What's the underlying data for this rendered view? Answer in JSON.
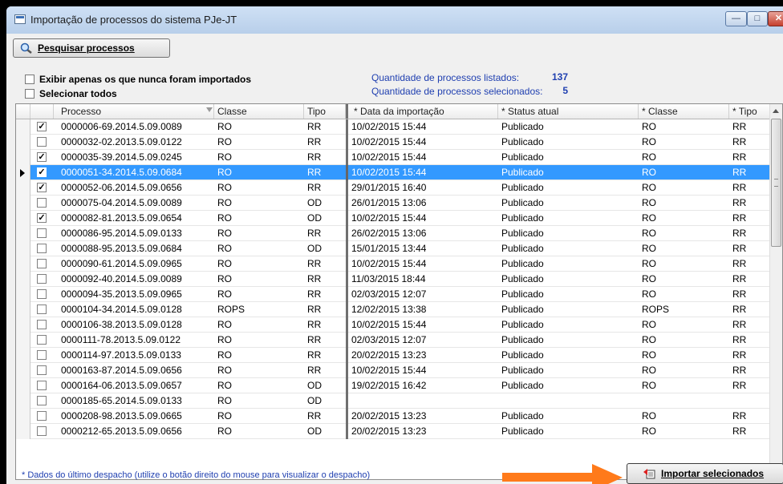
{
  "window": {
    "title": "Importação de processos do sistema PJe-JT"
  },
  "toolbar": {
    "search_label": "Pesquisar processos"
  },
  "options": {
    "only_never_imported": "Exibir apenas os que nunca foram importados",
    "select_all": "Selecionar todos"
  },
  "stats": {
    "listed_label": "Quantidade de processos listados:",
    "listed_value": "137",
    "selected_label": "Quantidade de processos selecionados:",
    "selected_value": "5"
  },
  "grid": {
    "columns": [
      "Processo",
      "Classe",
      "Tipo",
      "* Data da importação",
      "* Status atual",
      "* Classe",
      "* Tipo"
    ],
    "rows": [
      {
        "checked": true,
        "selected": false,
        "processo": "0000006-69.2014.5.09.0089",
        "classe": "RO",
        "tipo": "RR",
        "data": "10/02/2015 15:44",
        "status": "Publicado",
        "classe2": "RO",
        "tipo2": "RR"
      },
      {
        "checked": false,
        "selected": false,
        "processo": "0000032-02.2013.5.09.0122",
        "classe": "RO",
        "tipo": "RR",
        "data": "10/02/2015 15:44",
        "status": "Publicado",
        "classe2": "RO",
        "tipo2": "RR"
      },
      {
        "checked": true,
        "selected": false,
        "processo": "0000035-39.2014.5.09.0245",
        "classe": "RO",
        "tipo": "RR",
        "data": "10/02/2015 15:44",
        "status": "Publicado",
        "classe2": "RO",
        "tipo2": "RR"
      },
      {
        "checked": true,
        "selected": true,
        "processo": "0000051-34.2014.5.09.0684",
        "classe": "RO",
        "tipo": "RR",
        "data": "10/02/2015 15:44",
        "status": "Publicado",
        "classe2": "RO",
        "tipo2": "RR"
      },
      {
        "checked": true,
        "selected": false,
        "processo": "0000052-06.2014.5.09.0656",
        "classe": "RO",
        "tipo": "RR",
        "data": "29/01/2015 16:40",
        "status": "Publicado",
        "classe2": "RO",
        "tipo2": "RR"
      },
      {
        "checked": false,
        "selected": false,
        "processo": "0000075-04.2014.5.09.0089",
        "classe": "RO",
        "tipo": "OD",
        "data": "26/01/2015 13:06",
        "status": "Publicado",
        "classe2": "RO",
        "tipo2": "RR"
      },
      {
        "checked": true,
        "selected": false,
        "processo": "0000082-81.2013.5.09.0654",
        "classe": "RO",
        "tipo": "OD",
        "data": "10/02/2015 15:44",
        "status": "Publicado",
        "classe2": "RO",
        "tipo2": "RR"
      },
      {
        "checked": false,
        "selected": false,
        "processo": "0000086-95.2014.5.09.0133",
        "classe": "RO",
        "tipo": "RR",
        "data": "26/02/2015 13:06",
        "status": "Publicado",
        "classe2": "RO",
        "tipo2": "RR"
      },
      {
        "checked": false,
        "selected": false,
        "processo": "0000088-95.2013.5.09.0684",
        "classe": "RO",
        "tipo": "OD",
        "data": "15/01/2015 13:44",
        "status": "Publicado",
        "classe2": "RO",
        "tipo2": "RR"
      },
      {
        "checked": false,
        "selected": false,
        "processo": "0000090-61.2014.5.09.0965",
        "classe": "RO",
        "tipo": "RR",
        "data": "10/02/2015 15:44",
        "status": "Publicado",
        "classe2": "RO",
        "tipo2": "RR"
      },
      {
        "checked": false,
        "selected": false,
        "processo": "0000092-40.2014.5.09.0089",
        "classe": "RO",
        "tipo": "RR",
        "data": "11/03/2015 18:44",
        "status": "Publicado",
        "classe2": "RO",
        "tipo2": "RR"
      },
      {
        "checked": false,
        "selected": false,
        "processo": "0000094-35.2013.5.09.0965",
        "classe": "RO",
        "tipo": "RR",
        "data": "02/03/2015 12:07",
        "status": "Publicado",
        "classe2": "RO",
        "tipo2": "RR"
      },
      {
        "checked": false,
        "selected": false,
        "processo": "0000104-34.2014.5.09.0128",
        "classe": "ROPS",
        "tipo": "RR",
        "data": "12/02/2015 13:38",
        "status": "Publicado",
        "classe2": "ROPS",
        "tipo2": "RR"
      },
      {
        "checked": false,
        "selected": false,
        "processo": "0000106-38.2013.5.09.0128",
        "classe": "RO",
        "tipo": "RR",
        "data": "10/02/2015 15:44",
        "status": "Publicado",
        "classe2": "RO",
        "tipo2": "RR"
      },
      {
        "checked": false,
        "selected": false,
        "processo": "0000111-78.2013.5.09.0122",
        "classe": "RO",
        "tipo": "RR",
        "data": "02/03/2015 12:07",
        "status": "Publicado",
        "classe2": "RO",
        "tipo2": "RR"
      },
      {
        "checked": false,
        "selected": false,
        "processo": "0000114-97.2013.5.09.0133",
        "classe": "RO",
        "tipo": "RR",
        "data": "20/02/2015 13:23",
        "status": "Publicado",
        "classe2": "RO",
        "tipo2": "RR"
      },
      {
        "checked": false,
        "selected": false,
        "processo": "0000163-87.2014.5.09.0656",
        "classe": "RO",
        "tipo": "RR",
        "data": "10/02/2015 15:44",
        "status": "Publicado",
        "classe2": "RO",
        "tipo2": "RR"
      },
      {
        "checked": false,
        "selected": false,
        "processo": "0000164-06.2013.5.09.0657",
        "classe": "RO",
        "tipo": "OD",
        "data": "19/02/2015 16:42",
        "status": "Publicado",
        "classe2": "RO",
        "tipo2": "RR"
      },
      {
        "checked": false,
        "selected": false,
        "processo": "0000185-65.2014.5.09.0133",
        "classe": "RO",
        "tipo": "OD",
        "data": "",
        "status": "",
        "classe2": "",
        "tipo2": ""
      },
      {
        "checked": false,
        "selected": false,
        "processo": "0000208-98.2013.5.09.0665",
        "classe": "RO",
        "tipo": "RR",
        "data": "20/02/2015 13:23",
        "status": "Publicado",
        "classe2": "RO",
        "tipo2": "RR"
      },
      {
        "checked": false,
        "selected": false,
        "processo": "0000212-65.2013.5.09.0656",
        "classe": "RO",
        "tipo": "OD",
        "data": "20/02/2015 13:23",
        "status": "Publicado",
        "classe2": "RO",
        "tipo2": "RR"
      }
    ]
  },
  "footer": {
    "note": "* Dados do último despacho (utilize o botão direito do mouse para visualizar o despacho)",
    "import_label": "Importar selecionados"
  },
  "colors": {
    "selection": "#3399ff",
    "info_text": "#1f3fb0",
    "arrow": "#ff7a1a"
  }
}
